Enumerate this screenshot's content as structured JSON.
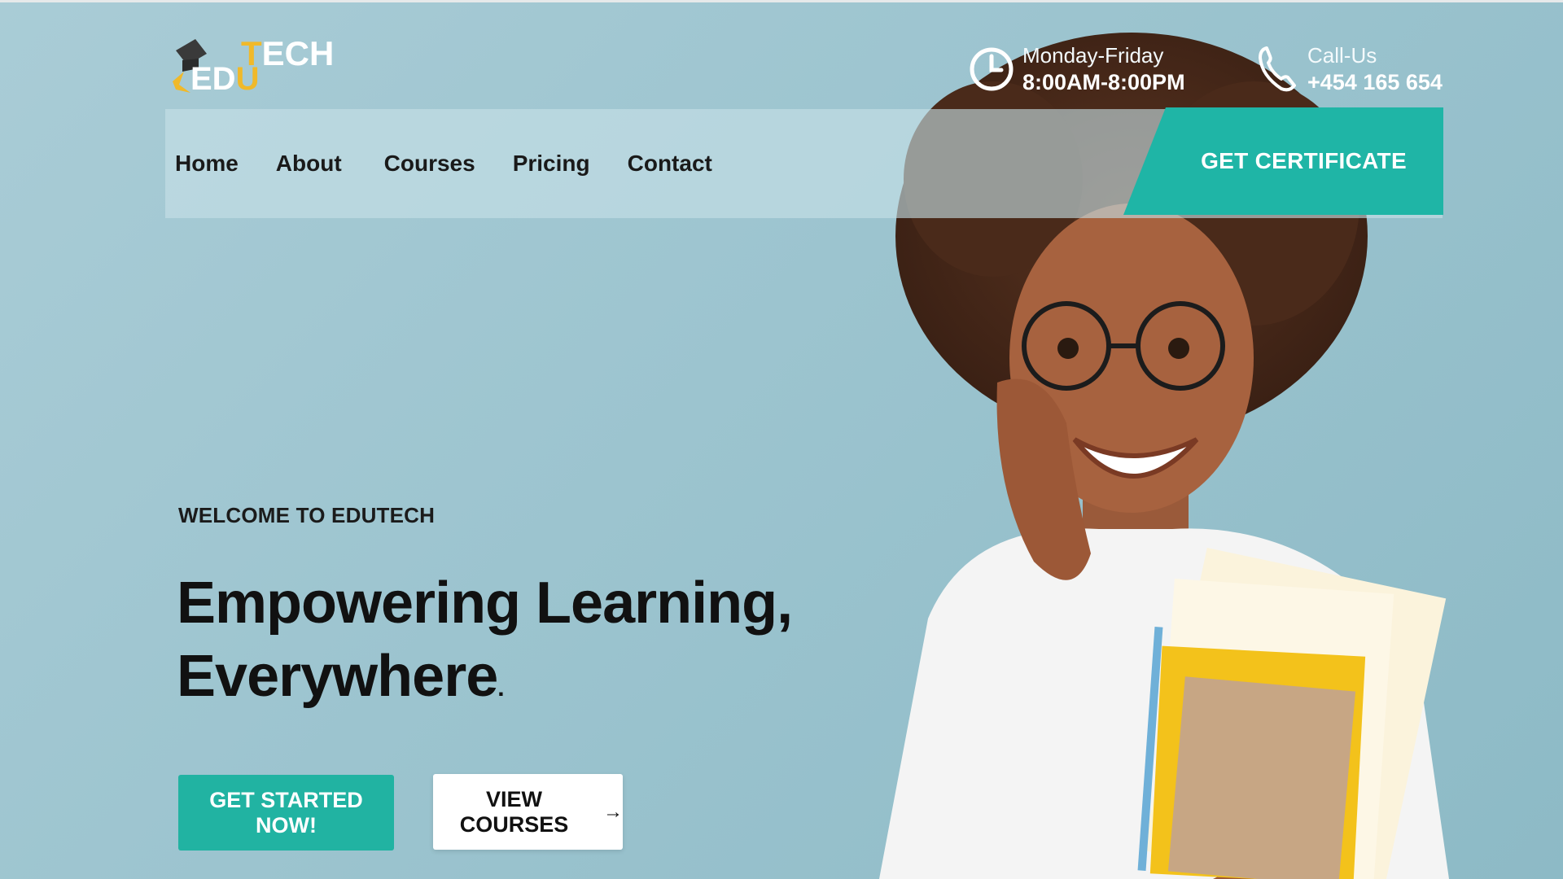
{
  "brand": {
    "logo_top": "TECH",
    "logo_top_first": "T",
    "logo_top_rest": "ECH",
    "logo_bottom_rest": "ED",
    "logo_bottom_last": "U"
  },
  "header": {
    "hours_label": "Monday-Friday",
    "hours_value": "8:00AM-8:00PM",
    "call_label": "Call-Us",
    "call_value": "+454 165 654"
  },
  "nav": {
    "items": [
      {
        "label": "Home"
      },
      {
        "label": "About"
      },
      {
        "label": "Courses"
      },
      {
        "label": "Pricing"
      },
      {
        "label": "Contact"
      }
    ],
    "cta_label": "GET CERTIFICATE"
  },
  "hero": {
    "eyebrow": "WELCOME TO EDUTECH",
    "headline_line1": "Empowering Learning,",
    "headline_line2": "Everywhere",
    "headline_dot": ".",
    "primary_button": "GET STARTED NOW!",
    "secondary_button": "VIEW COURSES",
    "secondary_arrow": "→"
  },
  "colors": {
    "accent": "#1fb5a6",
    "logo_gold": "#f0b92a",
    "background": "#9cc4cf"
  },
  "icons": {
    "hours": "clock-icon",
    "call": "phone-icon",
    "logo": "graduation-cap-icon"
  }
}
